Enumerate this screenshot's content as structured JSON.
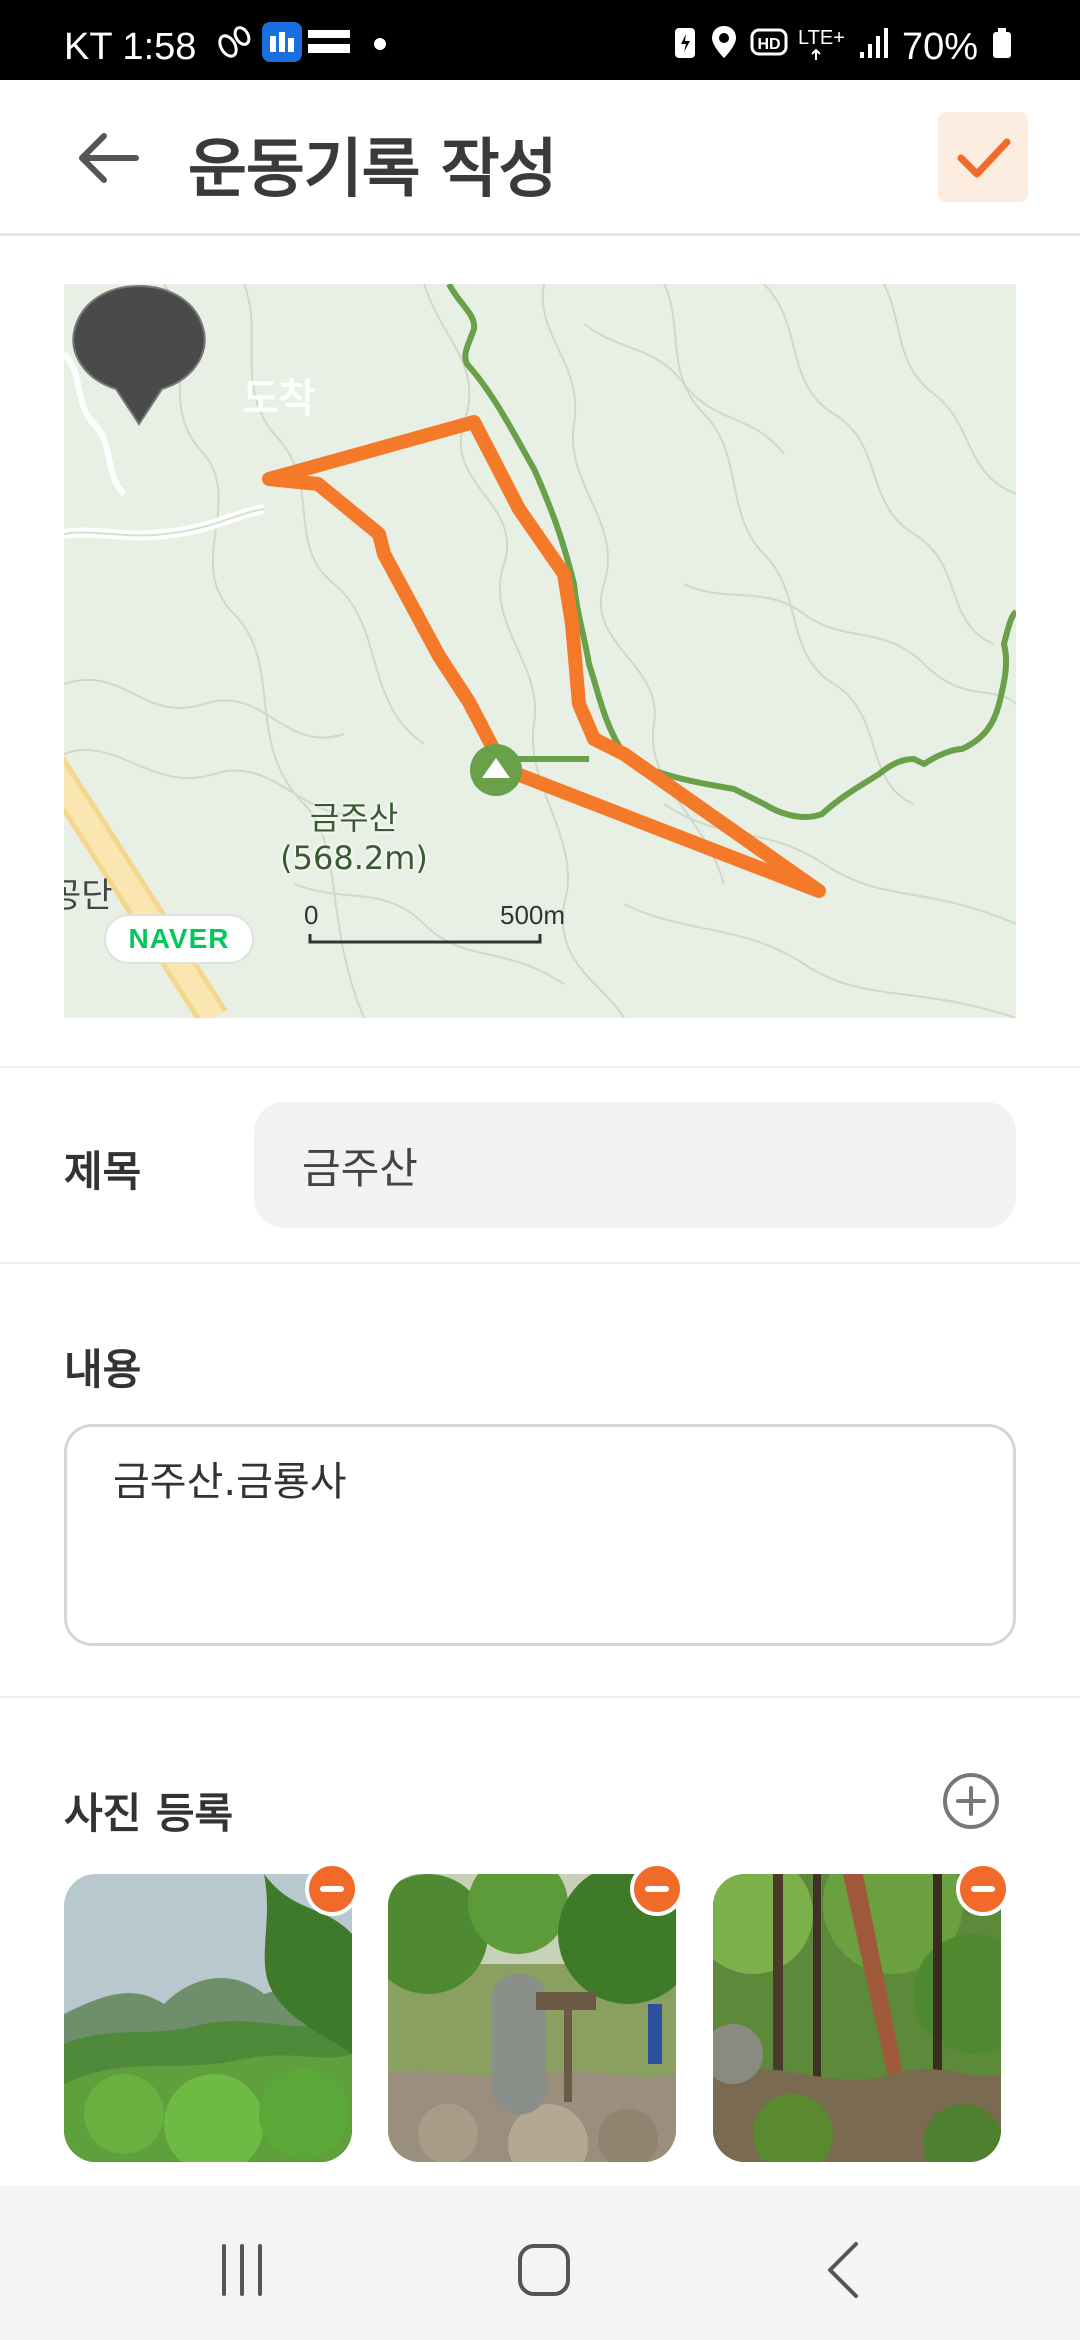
{
  "status_bar": {
    "time": "KT 1:58",
    "battery": "70%",
    "icons": [
      "steps-icon",
      "temu-app-icon",
      "dot-icon",
      "battery-saver-icon",
      "location-icon",
      "hd-icon",
      "lte-icon",
      "signal-icon",
      "battery-icon"
    ]
  },
  "header": {
    "title": "운동기록 작성",
    "back_icon": "arrow-left-icon",
    "confirm_icon": "check-icon"
  },
  "map": {
    "pin_label": "도착",
    "peak_name": "금주산",
    "peak_elevation": "(568.2m)",
    "edge_text": "공단",
    "logo": "NAVER",
    "scale_start": "0",
    "scale_end": "500m",
    "route_color": "#f47a2a",
    "trail_color": "#6aa04a"
  },
  "form": {
    "title_label": "제목",
    "title_value": "금주산",
    "content_label": "내용",
    "content_value": "금주산.금룡사",
    "photo_label": "사진 등록",
    "add_icon": "plus-circle-icon",
    "remove_icon": "minus-circle-icon"
  },
  "nav": {
    "icons": [
      "recent-apps-icon",
      "home-icon",
      "back-icon"
    ]
  },
  "colors": {
    "accent": "#f26a2a",
    "accent_light": "#fdece0"
  }
}
